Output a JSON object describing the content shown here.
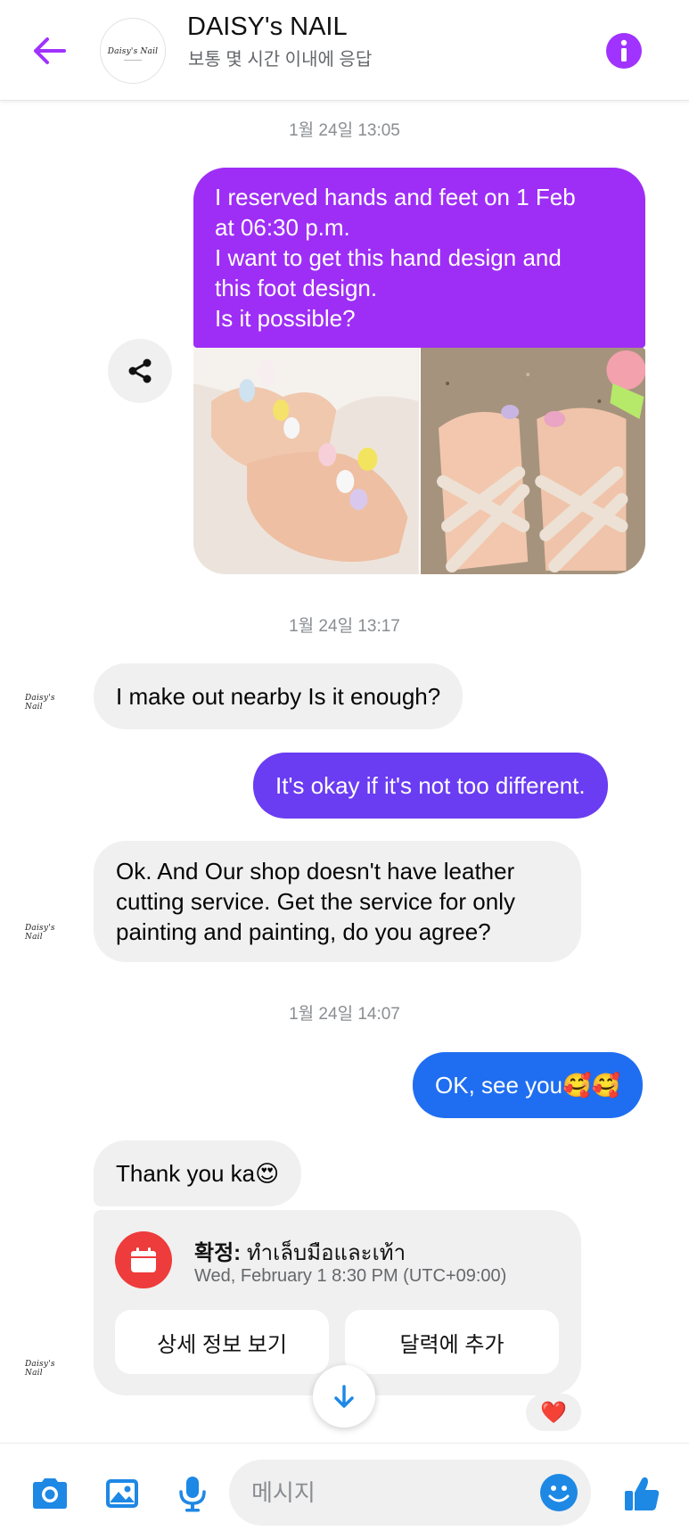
{
  "header": {
    "title": "DAISY's NAIL",
    "subtitle": "보통 몇 시간 이내에 응답",
    "logo_text": "Daisy's Nail"
  },
  "timestamps": [
    "1월 24일 13:05",
    "1월 24일 13:17",
    "1월 24일 14:07"
  ],
  "messages": [
    {
      "from": "me",
      "lines": [
        "I reserved hands and feet on 1 Feb",
        "at 06:30 p.m.",
        "I want to get this hand design and",
        "this foot design.",
        "Is it possible?"
      ]
    },
    {
      "from": "shop",
      "text": "I make out nearby Is it enough?"
    },
    {
      "from": "me",
      "text": "It's okay if it's not too different."
    },
    {
      "from": "shop",
      "lines": [
        "Ok. And Our shop doesn't have leather",
        "cutting service. Get the service for only",
        "painting and painting, do you agree?"
      ]
    },
    {
      "from": "me",
      "text": "OK, see you🥰🥰"
    },
    {
      "from": "shop",
      "text": "Thank you ka😍"
    }
  ],
  "event": {
    "label": "확정:",
    "name": "ทำเล็บมือและเท้า",
    "time": "Wed, February 1 8:30 PM (UTC+09:00)",
    "details_button": "상세 정보 보기",
    "calendar_button": "달력에 추가"
  },
  "reaction": "❤️",
  "composer": {
    "placeholder": "메시지"
  },
  "colors": {
    "accent": "#a033ff",
    "bubble_purple": "#9e2ef6",
    "bubble_indigo": "#6a3cf2",
    "bubble_blue": "#1f6ef1",
    "incoming": "#f0f0f0",
    "composer_icons": "#1e88e5"
  },
  "icons": [
    "back-arrow-icon",
    "info-icon",
    "share-icon",
    "calendar-icon",
    "arrow-down-icon",
    "camera-icon",
    "gallery-icon",
    "mic-icon",
    "emoji-icon",
    "thumbs-up-icon"
  ]
}
